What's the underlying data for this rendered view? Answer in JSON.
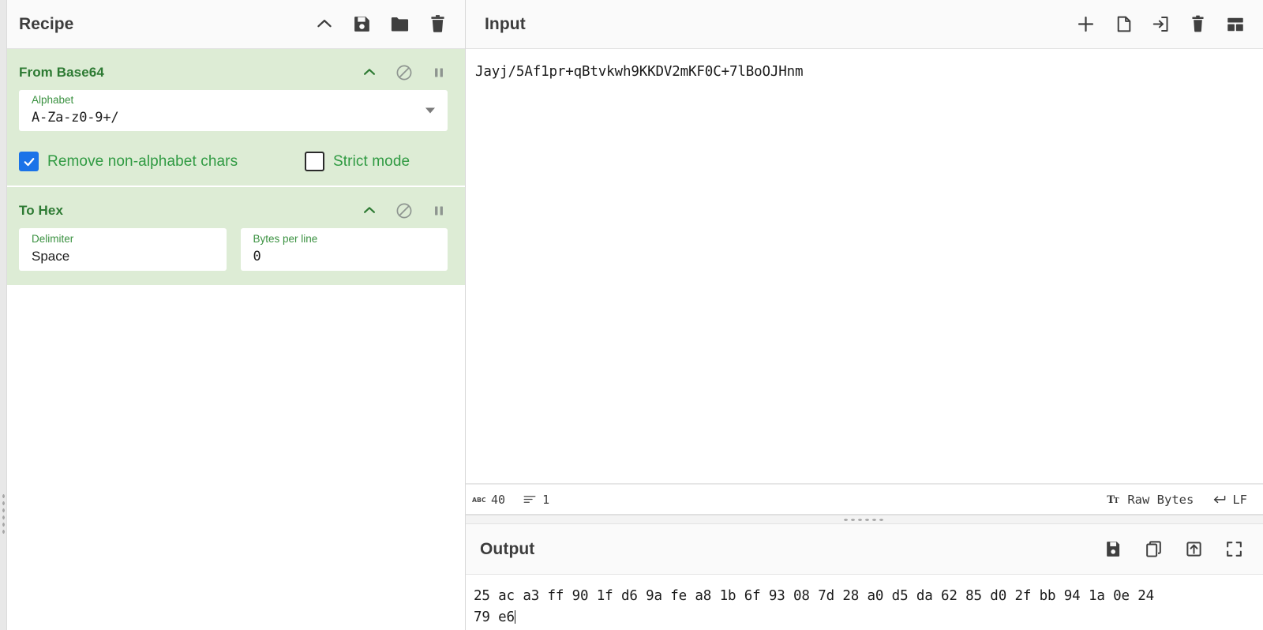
{
  "recipe": {
    "title": "Recipe",
    "header_icons": [
      {
        "name": "collapse-chevron-icon",
        "label": "Collapse"
      },
      {
        "name": "save-recipe-icon",
        "label": "Save recipe"
      },
      {
        "name": "load-recipe-icon",
        "label": "Load recipe"
      },
      {
        "name": "clear-recipe-icon",
        "label": "Clear recipe"
      }
    ],
    "operations": [
      {
        "name": "From Base64",
        "icons": [
          {
            "name": "collapse-chevron-icon"
          },
          {
            "name": "disable-operation-icon"
          },
          {
            "name": "pause-breakpoint-icon"
          }
        ],
        "fields": [
          {
            "type": "select",
            "label": "Alphabet",
            "value": "A-Za-z0-9+/"
          }
        ],
        "checkboxes": [
          {
            "label": "Remove non-alphabet chars",
            "checked": true
          },
          {
            "label": "Strict mode",
            "checked": false
          }
        ]
      },
      {
        "name": "To Hex",
        "icons": [
          {
            "name": "collapse-chevron-icon"
          },
          {
            "name": "disable-operation-icon"
          },
          {
            "name": "pause-breakpoint-icon"
          }
        ],
        "fields": [
          {
            "type": "text",
            "label": "Delimiter",
            "value": "Space"
          },
          {
            "type": "text",
            "label": "Bytes per line",
            "value": "0"
          }
        ],
        "checkboxes": []
      }
    ]
  },
  "input": {
    "title": "Input",
    "header_icons": [
      {
        "name": "add-input-tab-icon",
        "label": "Add a new input tab"
      },
      {
        "name": "open-file-icon",
        "label": "Open file as input"
      },
      {
        "name": "open-folder-as-input-icon",
        "label": "Open folder as input"
      },
      {
        "name": "clear-input-icon",
        "label": "Clear input and output"
      },
      {
        "name": "reset-pane-layout-icon",
        "label": "Reset pane layout"
      }
    ],
    "text": "Jayj/5Af1pr+qBtvkwh9KKDV2mKF0C+7lBoOJHnm",
    "status": {
      "length_icon": "character-count-icon",
      "length": "40",
      "lines_icon": "line-count-icon",
      "lines": "1",
      "encoding_icon": "character-encoding-icon",
      "encoding": "Raw Bytes",
      "eol_icon": "line-ending-icon",
      "eol": "LF"
    }
  },
  "output": {
    "title": "Output",
    "header_icons": [
      {
        "name": "save-output-icon",
        "label": "Save output to file"
      },
      {
        "name": "copy-output-icon",
        "label": "Copy raw output to clipboard"
      },
      {
        "name": "replace-input-with-output-icon",
        "label": "Replace input with output"
      },
      {
        "name": "maximise-output-icon",
        "label": "Maximise output pane"
      }
    ],
    "lines": [
      "25 ac a3 ff 90 1f d6 9a fe a8 1b 6f 93 08 7d 28 a0 d5 da 62 85 d0 2f bb 94 1a 0e 24",
      "79 e6"
    ]
  },
  "colors": {
    "operation_bg": "#ddecd5",
    "operation_title": "#2d7a33",
    "field_label": "#3a9140",
    "checkbox_label": "#2f9a42",
    "checkbox_checked": "#1a73e8",
    "header_bg": "#fafafa",
    "text": "#3c3c3c"
  }
}
